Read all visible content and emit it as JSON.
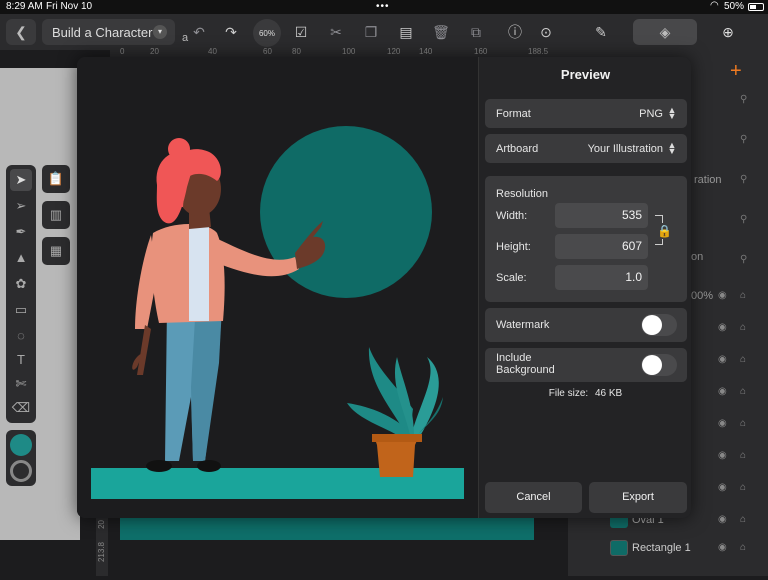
{
  "status": {
    "time": "8:29 AM",
    "date": "Fri Nov 10",
    "battery": "50%"
  },
  "toolbar": {
    "back_icon": "chevron-left-icon",
    "doc_title": "Build a Character",
    "zoom": "60%"
  },
  "ruler": {
    "ticks": [
      "0",
      "20",
      "40",
      "60",
      "80",
      "100",
      "120",
      "140",
      "160",
      "188.5"
    ]
  },
  "vruler": {
    "ticks": [
      "20",
      "213.8"
    ]
  },
  "layers": {
    "items": [
      {
        "label": "ration"
      },
      {
        "label": "on"
      },
      {
        "label": "00%"
      },
      {
        "label": "Oval 1"
      },
      {
        "label": "Rectangle 1"
      }
    ]
  },
  "dialog": {
    "title": "Preview",
    "format": {
      "label": "Format",
      "value": "PNG"
    },
    "artboard": {
      "label": "Artboard",
      "value": "Your Illustration"
    },
    "resolution": {
      "heading": "Resolution",
      "width_label": "Width:",
      "width": "535",
      "height_label": "Height:",
      "height": "607",
      "scale_label": "Scale:",
      "scale": "1.0"
    },
    "watermark": {
      "label": "Watermark",
      "on": false
    },
    "include_background": {
      "label": "Include Background",
      "on": false
    },
    "file_size": {
      "label": "File size:",
      "value": "46 KB"
    },
    "cancel": "Cancel",
    "export": "Export"
  },
  "colors": {
    "teal_circle": "#0f6b66",
    "ground": "#1aa59b",
    "hair": "#f05656",
    "skin": "#6b3a2a",
    "jacket": "#e8927c",
    "pants": "#5b9bb7",
    "pot": "#c1641b",
    "leaves": "#1e8a86",
    "accent": "#f07b22"
  }
}
